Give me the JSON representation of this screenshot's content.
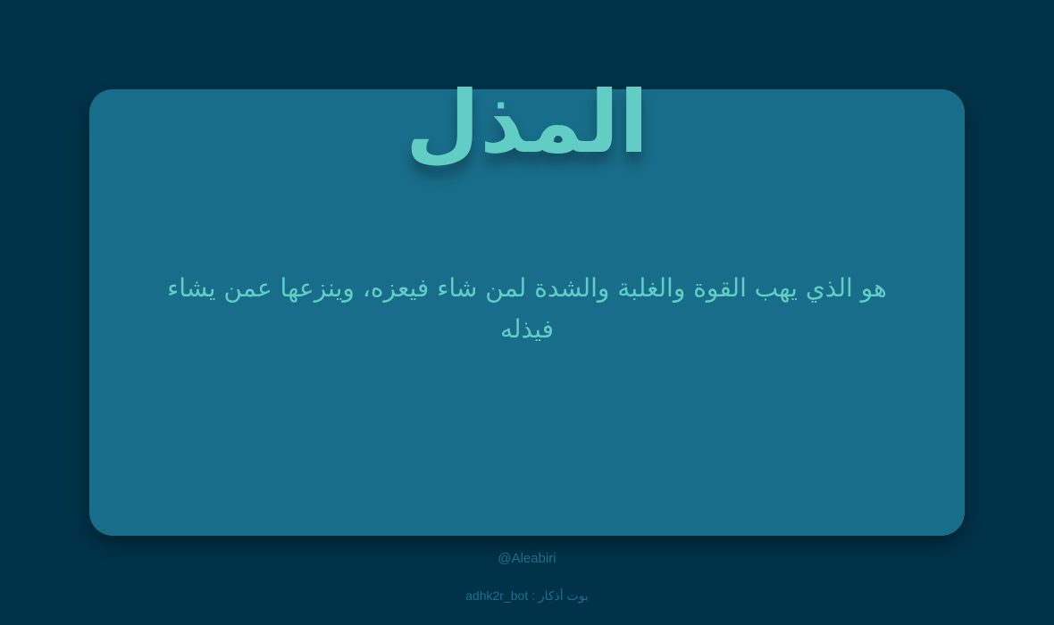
{
  "card": {
    "title": "المذل",
    "description": "هو الذي يهب القوة والغلبة والشدة لمن شاء فيعزه، وينزعها عمن يشاء فيذله"
  },
  "footer": {
    "handle": "@Aleabiri",
    "bot_credit": "بوت أذكار : adhk2r_bot"
  },
  "colors": {
    "background": "#003349",
    "card": "#186d8a",
    "accent": "#61cdc4",
    "footer_text": "#1d6f8d"
  }
}
